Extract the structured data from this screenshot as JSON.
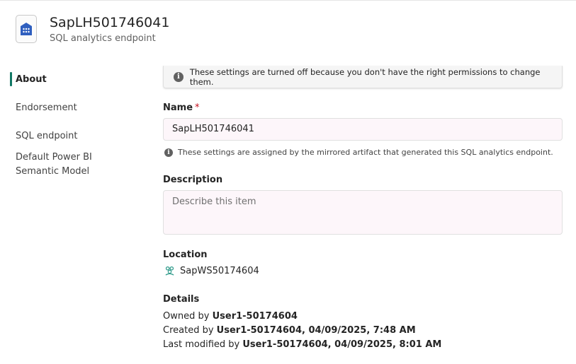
{
  "header": {
    "title": "SapLH501746041",
    "subtitle": "SQL analytics endpoint",
    "icon": "sql-endpoint-icon",
    "icon_color": "#2f5fbf"
  },
  "sidebar": {
    "items": [
      {
        "label": "About",
        "active": true
      },
      {
        "label": "Endorsement",
        "active": false
      },
      {
        "label": "SQL endpoint",
        "active": false
      },
      {
        "label": "Default Power BI Semantic Model",
        "active": false
      }
    ],
    "accent": "#117865"
  },
  "banner": {
    "text": "These settings are turned off because you don't have the right permissions to change them."
  },
  "name_field": {
    "label": "Name",
    "required_mark": "*",
    "value": "SapLH501746041",
    "hint": "These settings are assigned by the mirrored artifact that generated this SQL analytics endpoint."
  },
  "description_field": {
    "label": "Description",
    "placeholder": "Describe this item"
  },
  "location": {
    "label": "Location",
    "workspace": "SapWS50174604",
    "icon": "workspace-icon",
    "icon_color": "#2e9a8a"
  },
  "details": {
    "label": "Details",
    "owned_prefix": "Owned by",
    "owner": "User1-50174604",
    "created_prefix": "Created by",
    "created_value": "User1-50174604, 04/09/2025, 7:48 AM",
    "modified_prefix": "Last modified by",
    "modified_value": "User1-50174604, 04/09/2025, 8:01 AM"
  }
}
